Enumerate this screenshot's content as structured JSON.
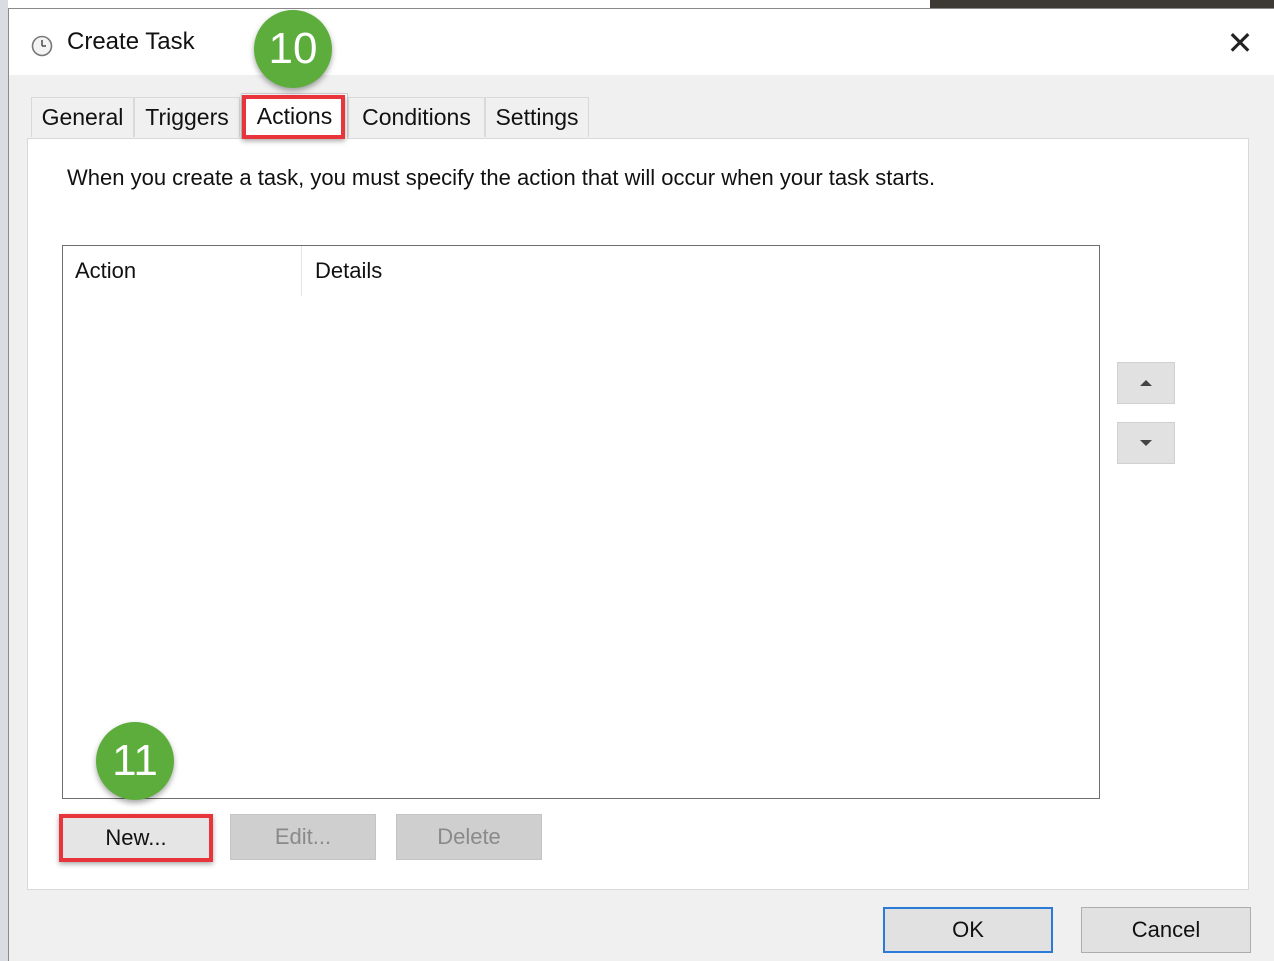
{
  "window": {
    "title": "Create Task",
    "close_glyph": "✕"
  },
  "tabs": [
    {
      "label": "General"
    },
    {
      "label": "Triggers"
    },
    {
      "label": "Actions",
      "selected": true
    },
    {
      "label": "Conditions"
    },
    {
      "label": "Settings"
    }
  ],
  "actions_panel": {
    "instruction": "When you create a task, you must specify the action that will occur when your task starts.",
    "columns": [
      "Action",
      "Details"
    ],
    "rows": []
  },
  "buttons": {
    "new": "New...",
    "edit": "Edit...",
    "delete": "Delete",
    "ok": "OK",
    "cancel": "Cancel"
  },
  "annotations": {
    "step_10": "10",
    "step_11": "11",
    "highlight_color": "#e8343b",
    "badge_color": "#5cad3c"
  },
  "icons": {
    "app": "clock-icon",
    "move_up": "triangle-up-icon",
    "move_down": "triangle-down-icon"
  }
}
